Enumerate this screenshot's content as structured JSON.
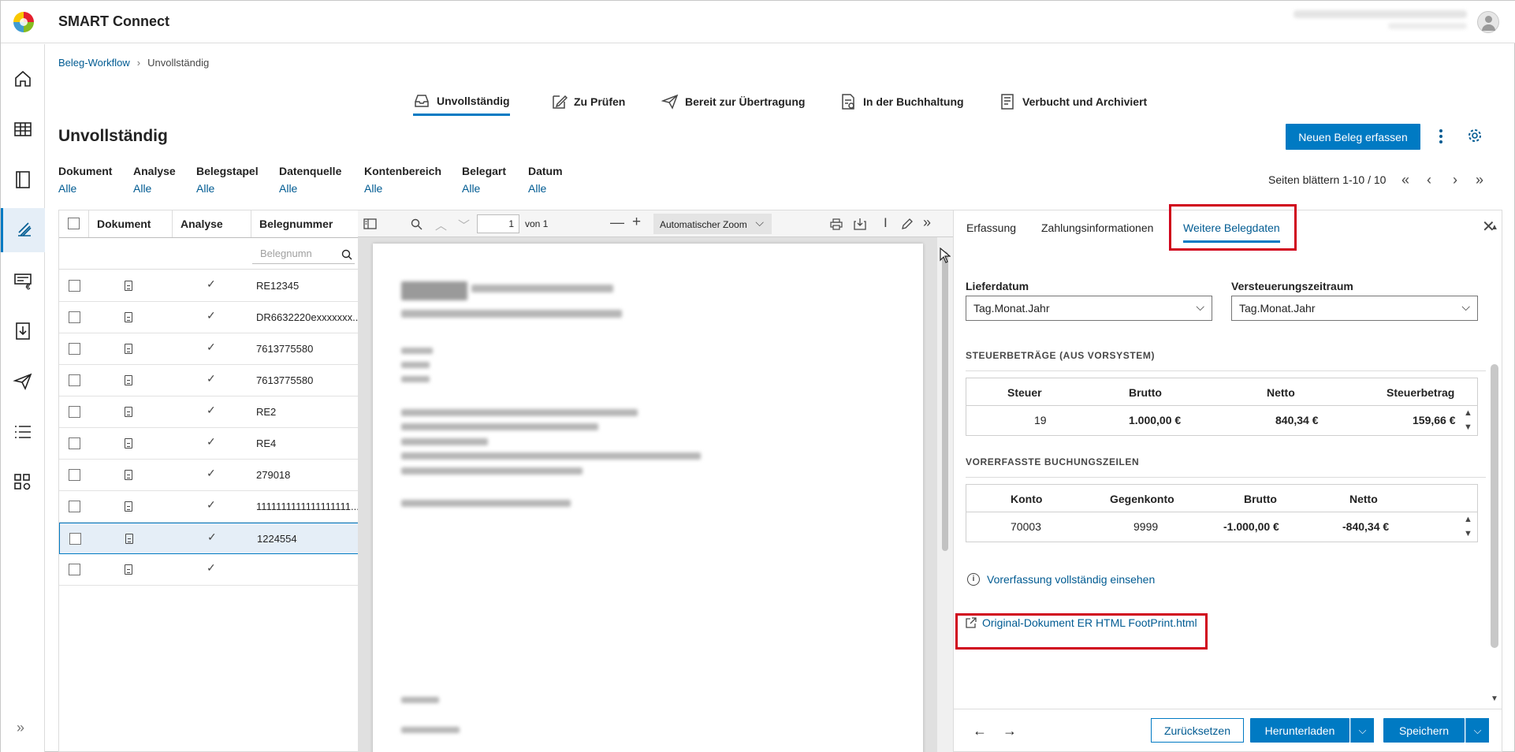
{
  "app": {
    "title": "SMART Connect"
  },
  "breadcrumb": {
    "root": "Beleg-Workflow",
    "current": "Unvollständig"
  },
  "status_tabs": [
    {
      "label": "Unvollständig",
      "icon": "inbox-icon"
    },
    {
      "label": "Zu Prüfen",
      "icon": "edit-icon"
    },
    {
      "label": "Bereit zur Übertragung",
      "icon": "send-icon"
    },
    {
      "label": "In der Buchhaltung",
      "icon": "ledger-icon"
    },
    {
      "label": "Verbucht und Archiviert",
      "icon": "archive-icon"
    }
  ],
  "page": {
    "title": "Unvollständig",
    "new_button": "Neuen Beleg erfassen"
  },
  "filters": [
    {
      "label": "Dokument",
      "value": "Alle"
    },
    {
      "label": "Analyse",
      "value": "Alle"
    },
    {
      "label": "Belegstapel",
      "value": "Alle"
    },
    {
      "label": "Datenquelle",
      "value": "Alle"
    },
    {
      "label": "Kontenbereich",
      "value": "Alle"
    },
    {
      "label": "Belegart",
      "value": "Alle"
    },
    {
      "label": "Datum",
      "value": "Alle"
    }
  ],
  "pager": {
    "text": "Seiten blättern 1-10 / 10"
  },
  "table": {
    "columns": [
      "Dokument",
      "Analyse",
      "Belegnummer"
    ],
    "search_placeholder": "Belegnumn",
    "rows": [
      {
        "belegnummer": "RE12345"
      },
      {
        "belegnummer": "DR6632220exxxxxxx.."
      },
      {
        "belegnummer": "7613775580"
      },
      {
        "belegnummer": "7613775580"
      },
      {
        "belegnummer": "RE2"
      },
      {
        "belegnummer": "RE4"
      },
      {
        "belegnummer": "279018"
      },
      {
        "belegnummer": "1111111111111111111..."
      },
      {
        "belegnummer": "1224554"
      },
      {
        "belegnummer": ""
      }
    ]
  },
  "viewer": {
    "page_number": "1",
    "page_of": "von 1",
    "zoom": "Automatischer Zoom"
  },
  "panel": {
    "tabs": [
      "Erfassung",
      "Zahlungsinformationen",
      "Weitere Belegdaten"
    ],
    "lieferdatum_label": "Lieferdatum",
    "lieferdatum_value": "Tag.Monat.Jahr",
    "versteuerung_label": "Versteuerungszeitraum",
    "versteuerung_value": "Tag.Monat.Jahr",
    "steuer_section": "STEUERBETRÄGE (AUS VORSYSTEM)",
    "steuer_headers": [
      "Steuer",
      "Brutto",
      "Netto",
      "Steuerbetrag"
    ],
    "steuer_row": [
      "19",
      "1.000,00 €",
      "840,34 €",
      "159,66 €"
    ],
    "buchung_section": "VORERFASSTE BUCHUNGSZEILEN",
    "buchung_headers": [
      "Konto",
      "Gegenkonto",
      "Brutto",
      "Netto"
    ],
    "buchung_row": [
      "70003",
      "9999",
      "-1.000,00 €",
      "-840,34 €"
    ],
    "info_link": "Vorerfassung vollständig einsehen",
    "original_link": "Original-Dokument ER HTML FootPrint.html",
    "reset_button": "Zurücksetzen",
    "download_button": "Herunterladen",
    "save_button": "Speichern"
  },
  "colors": {
    "accent": "#007ac3",
    "link": "#005b92",
    "highlight": "#d0021b"
  }
}
